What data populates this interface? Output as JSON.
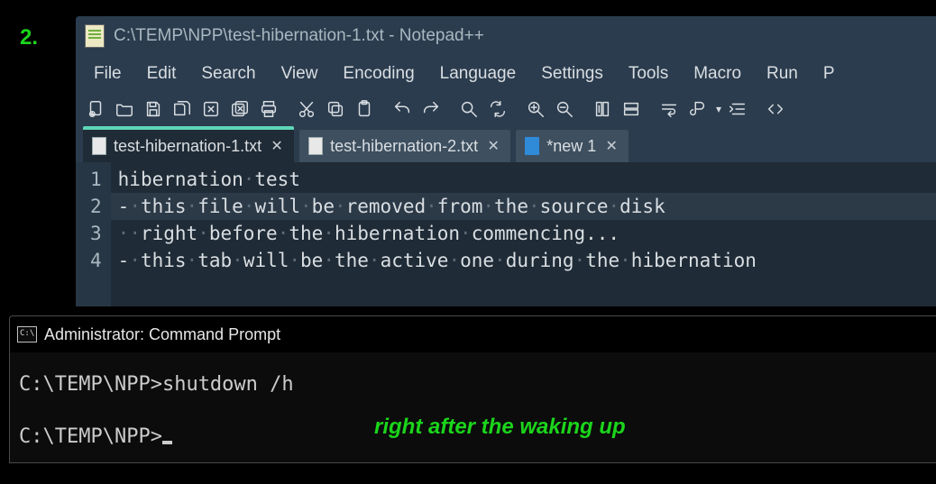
{
  "step_number": "2.",
  "annotation": "right after the waking up",
  "notepadpp": {
    "title": "C:\\TEMP\\NPP\\test-hibernation-1.txt - Notepad++",
    "menu": [
      "File",
      "Edit",
      "Search",
      "View",
      "Encoding",
      "Language",
      "Settings",
      "Tools",
      "Macro",
      "Run",
      "P"
    ],
    "toolbar_icons": [
      "new-file",
      "open-folder",
      "save",
      "save-all",
      "close",
      "close-all",
      "print",
      "cut",
      "copy",
      "paste",
      "undo",
      "redo",
      "find",
      "replace",
      "zoom-in",
      "zoom-out",
      "sync-v",
      "sync-h",
      "word-wrap",
      "show-all",
      "indent",
      "code-block"
    ],
    "tabs": [
      {
        "label": "test-hibernation-1.txt",
        "active": true,
        "icon": "white"
      },
      {
        "label": "test-hibernation-2.txt",
        "active": false,
        "icon": "white"
      },
      {
        "label": "*new 1",
        "active": false,
        "icon": "blue"
      }
    ],
    "editor": {
      "line_numbers": [
        "1",
        "2",
        "3",
        "4"
      ],
      "lines": [
        "hibernation test",
        "- this file will be removed from the source disk",
        "  right before the hibernation commencing...",
        "- this tab will be the active one during the hibernation"
      ],
      "highlighted_line_index": 1
    }
  },
  "cmd": {
    "title": "Administrator: Command Prompt",
    "prompt1": "C:\\TEMP\\NPP>",
    "command1": "shutdown /h",
    "prompt2": "C:\\TEMP\\NPP>"
  }
}
